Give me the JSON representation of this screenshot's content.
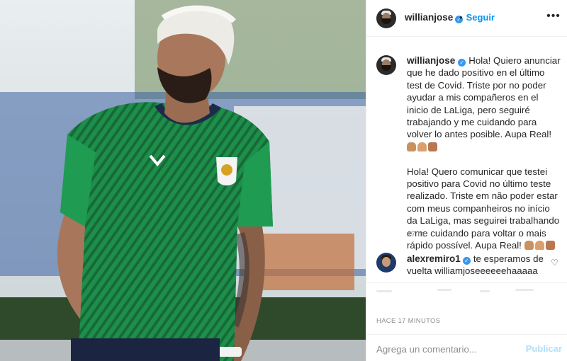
{
  "post": {
    "username": "willianjose",
    "verified": true,
    "follow_label": "Seguir",
    "more_label": "•••",
    "caption_es": "Hola! Quiero anunciar que he dado positivo en el último test de Covid. Triste por no poder ayudar a mis compañeros en el inicio de LaLiga, pero seguiré trabajando y me cuidando para volver lo antes posible. Aupa Real!",
    "caption_pt": "Hola! Quero comunicar que testei positivo para Covid no último teste realizado. Triste em não poder estar com meus companheiros no início da LaLiga, mas seguirei trabalhando e me cuidando para voltar o mais rápido possível. Aupa Real!",
    "caption_age": "17 m",
    "emojis": [
      "flexed-biceps-emoji",
      "praying-hands-emoji",
      "raised-hands-emoji"
    ]
  },
  "reply": {
    "username": "alexremiro1",
    "verified": true,
    "text": "te esperamos de vuelta williamjoseeeeeehaaaaa"
  },
  "footer": {
    "time_ago": "HACE 17 MINUTOS",
    "comment_placeholder": "Agrega un comentario...",
    "post_label": "Publicar"
  },
  "colors": {
    "link_blue": "#0095f6",
    "verified_blue": "#3897f0",
    "muted_gray": "#8e8e8e",
    "post_disabled": "#b2dffc",
    "jersey_green": "#1f8f4a"
  }
}
